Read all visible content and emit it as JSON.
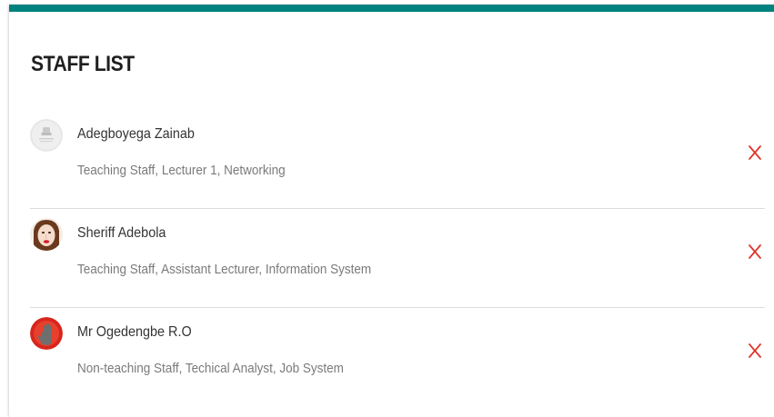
{
  "header": {
    "title": "STAFF LIST",
    "accent_color": "#00827f"
  },
  "staff": [
    {
      "name": "Adegboyega Zainab",
      "details": "Teaching Staff, Lecturer 1, Networking",
      "avatar_icon": "placeholder-avatar-icon"
    },
    {
      "name": "Sheriff Adebola",
      "details": "Teaching Staff, Assistant Lecturer, Information System",
      "avatar_icon": "portrait-avatar-icon"
    },
    {
      "name": "Mr Ogedengbe R.O",
      "details": "Non-teaching Staff, Techical Analyst, Job System",
      "avatar_icon": "hand-avatar-icon"
    }
  ],
  "actions": {
    "remove_icon": "close-x-icon",
    "remove_color": "#e0352b"
  }
}
